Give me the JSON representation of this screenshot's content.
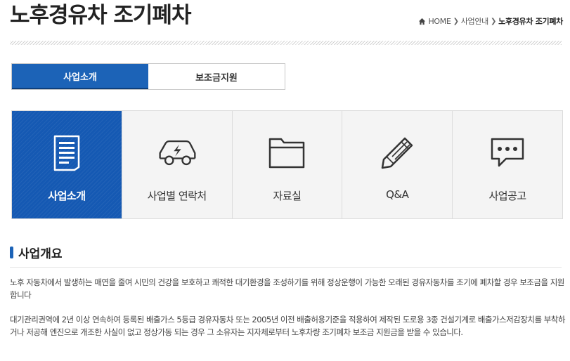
{
  "header": {
    "title": "노후경유차 조기폐차",
    "breadcrumb": [
      "HOME",
      "사업안내",
      "노후경유차 조기폐차"
    ]
  },
  "tabs": [
    {
      "label": "사업소개",
      "active": true
    },
    {
      "label": "보조금지원",
      "active": false
    }
  ],
  "cards": [
    {
      "label": "사업소개",
      "icon": "document-icon",
      "active": true
    },
    {
      "label": "사업별 연락처",
      "icon": "electric-car-icon",
      "active": false
    },
    {
      "label": "자료실",
      "icon": "folder-icon",
      "active": false
    },
    {
      "label": "Q&A",
      "icon": "pencil-icon",
      "active": false
    },
    {
      "label": "사업공고",
      "icon": "chat-bubble-icon",
      "active": false
    }
  ],
  "section": {
    "title": "사업개요",
    "paragraphs": [
      "노후 자동차에서 발생하는 매연을 줄여 시민의 건강을 보호하고 쾌적한 대기환경을 조성하기를 위해 정상운행이 가능한 오래된 경유자동차를 조기에 폐차할 경우 보조금을 지원합니다",
      "대기관리권역에 2년 이상 연속하여 등록된 배출가스 5등급 경유자동차 또는 2005년 이전 배출허용기준을 적용하여 제작된 도로용 3종 건설기계로 배출가스저감장치를 부착하거나 저공해 엔진으로 개조한 사실이 없고 정상가동 되는 경우 그 소유자는 지자체로부터 노후차량 조기폐차 보조금 지원금을 받을 수 있습니다."
    ]
  },
  "colors": {
    "accent": "#1c63b7",
    "active_card": "#1559b3",
    "card_bg": "#f4f4f4"
  }
}
